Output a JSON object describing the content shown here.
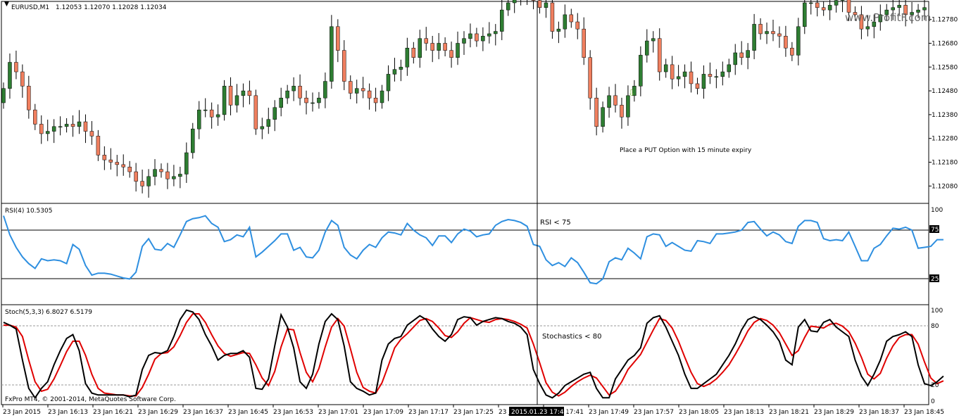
{
  "window": {
    "symbol": "EURUSD,M1",
    "quote": "1.12053 1.12070 1.12028 1.12034",
    "watermark": "www.ProfitF.com",
    "copyright": "FxPro MT4, © 2001-2014, MetaQuotes Software Corp."
  },
  "colors": {
    "bull": "#2e7d32",
    "bear": "#f07f5f",
    "wick": "#000000",
    "rsi": "#2e8fe0",
    "stoch_main": "#000000",
    "stoch_signal": "#e00000",
    "arrow": "#7fbf3f"
  },
  "cursor_time_label": "2015.01.23 17:40",
  "price_panel": {
    "ylim": [
      1.1201,
      1.1285
    ],
    "ticks": [
      "1.12780",
      "1.12680",
      "1.12580",
      "1.12480",
      "1.12380",
      "1.12280",
      "1.12180",
      "1.12080"
    ],
    "annotation": "Place a PUT Option with 15 minute expiry",
    "arrow_icon": "down-arrow-icon"
  },
  "rsi_panel": {
    "label": "RSI(4) 10.5305",
    "ticks": [
      "100",
      "75",
      "25",
      "0"
    ],
    "levels": [
      75,
      25
    ],
    "annotation": "RSI < 75"
  },
  "stoch_panel": {
    "label": "Stoch(5,3,3) 6.8027 6.5179",
    "ticks": [
      "100",
      "80",
      "20",
      "0"
    ],
    "levels": [
      80,
      20
    ],
    "annotation": "Stochastics < 80"
  },
  "x_axis": {
    "labels": [
      "23 Jan 2015",
      "23 Jan 16:13",
      "23 Jan 16:21",
      "23 Jan 16:29",
      "23 Jan 16:37",
      "23 Jan 16:45",
      "23 Jan 16:53",
      "23 Jan 17:01",
      "23 Jan 17:09",
      "23 Jan 17:17",
      "23 Jan 17:25",
      "23 Jan 17:33",
      "23 Jan 17:41",
      "23 Jan 17:49",
      "23 Jan 17:57",
      "23 Jan 18:05",
      "23 Jan 18:13",
      "23 Jan 18:21",
      "23 Jan 18:29",
      "23 Jan 18:37",
      "23 Jan 18:45"
    ]
  },
  "chart_data": {
    "type": "candlestick",
    "symbol": "EURUSD",
    "timeframe": "M1",
    "series": [
      {
        "name": "EURUSD,M1",
        "close": [
          1.1249,
          1.126,
          1.1256,
          1.125,
          1.124,
          1.1234,
          1.123,
          1.1231,
          1.1233,
          1.1233,
          1.1234,
          1.1233,
          1.1235,
          1.1231,
          1.1229,
          1.1221,
          1.1219,
          1.1218,
          1.1217,
          1.1216,
          1.1214,
          1.121,
          1.1208,
          1.1212,
          1.1215,
          1.1214,
          1.1211,
          1.1212,
          1.1213,
          1.1222,
          1.1232,
          1.124,
          1.124,
          1.1237,
          1.1238,
          1.125,
          1.1242,
          1.1246,
          1.1248,
          1.1246,
          1.1232,
          1.1233,
          1.1236,
          1.1241,
          1.1245,
          1.1248,
          1.125,
          1.1245,
          1.1243,
          1.1243,
          1.1245,
          1.1252,
          1.1275,
          1.1265,
          1.1252,
          1.1247,
          1.1249,
          1.1248,
          1.1245,
          1.1243,
          1.1248,
          1.1255,
          1.1257,
          1.1258,
          1.1266,
          1.1262,
          1.127,
          1.1268,
          1.1265,
          1.1268,
          1.1265,
          1.1262,
          1.1268,
          1.127,
          1.1272,
          1.1269,
          1.1271,
          1.1272,
          1.1273,
          1.1282,
          1.1285,
          1.1287,
          1.1289,
          1.129,
          1.1286,
          1.1283,
          1.1285,
          1.1273,
          1.1274,
          1.128,
          1.1277,
          1.1274,
          1.1262,
          1.1245,
          1.1233,
          1.1241,
          1.1246,
          1.1242,
          1.1237,
          1.1246,
          1.125,
          1.1263,
          1.1269,
          1.127,
          1.1256,
          1.1259,
          1.1253,
          1.1254,
          1.1256,
          1.1251,
          1.1249,
          1.1255,
          1.1254,
          1.1254,
          1.1256,
          1.1259,
          1.1264,
          1.1262,
          1.1265,
          1.1276,
          1.1272,
          1.1273,
          1.1272,
          1.1271,
          1.1266,
          1.1263,
          1.1275,
          1.1285,
          1.1285,
          1.1283,
          1.1282,
          1.1284,
          1.1286,
          1.1287,
          1.1281,
          1.128,
          1.1274,
          1.1275,
          1.1277,
          1.128,
          1.1282,
          1.1283,
          1.1284,
          1.128,
          1.1281,
          1.1282,
          1.1283
        ]
      },
      {
        "name": "RSI(4)",
        "values": [
          90,
          70,
          57,
          47,
          40,
          35,
          45,
          43,
          44,
          43,
          40,
          60,
          55,
          38,
          28,
          30,
          30,
          29,
          27,
          25,
          24,
          31,
          58,
          66,
          55,
          54,
          61,
          57,
          70,
          84,
          87,
          88,
          90,
          82,
          78,
          63,
          65,
          70,
          68,
          78,
          47,
          52,
          58,
          64,
          71,
          71,
          54,
          57,
          47,
          46,
          54,
          73,
          85,
          80,
          57,
          49,
          45,
          54,
          60,
          57,
          67,
          73,
          72,
          70,
          82,
          75,
          70,
          67,
          59,
          69,
          69,
          62,
          71,
          76,
          74,
          68,
          70,
          71,
          80,
          84,
          86,
          85,
          83,
          79,
          60,
          58,
          44,
          38,
          41,
          37,
          46,
          41,
          31,
          20,
          19,
          24,
          42,
          46,
          44,
          56,
          51,
          45,
          68,
          71,
          70,
          58,
          62,
          58,
          54,
          53,
          64,
          63,
          61,
          71,
          71,
          72,
          73,
          75,
          83,
          84,
          76,
          69,
          73,
          70,
          63,
          61,
          79,
          85,
          85,
          83,
          66,
          64,
          65,
          64,
          73,
          58,
          43,
          43,
          56,
          60,
          69,
          77,
          76,
          78,
          75,
          56,
          57,
          58,
          65,
          65
        ]
      },
      {
        "name": "Stoch(5,3,3) main",
        "values": [
          85,
          82,
          78,
          45,
          15,
          5,
          15,
          22,
          40,
          55,
          68,
          72,
          55,
          20,
          10,
          8,
          8,
          8,
          8,
          8,
          6,
          8,
          35,
          50,
          53,
          52,
          55,
          70,
          88,
          98,
          96,
          88,
          72,
          60,
          45,
          50,
          52,
          52,
          55,
          48,
          15,
          14,
          25,
          60,
          93,
          80,
          58,
          22,
          15,
          30,
          62,
          86,
          94,
          88,
          60,
          22,
          15,
          12,
          8,
          10,
          45,
          62,
          68,
          70,
          82,
          87,
          92,
          88,
          78,
          70,
          65,
          72,
          88,
          91,
          90,
          82,
          86,
          88,
          90,
          89,
          86,
          84,
          80,
          72,
          35,
          20,
          8,
          5,
          10,
          18,
          22,
          26,
          30,
          32,
          15,
          5,
          5,
          25,
          35,
          45,
          50,
          58,
          84,
          90,
          92,
          80,
          65,
          50,
          30,
          15,
          15,
          20,
          25,
          30,
          40,
          50,
          62,
          77,
          88,
          91,
          88,
          82,
          75,
          65,
          45,
          40,
          80,
          88,
          76,
          75,
          85,
          88,
          80,
          75,
          70,
          45,
          28,
          18,
          30,
          45,
          65,
          70,
          72,
          75,
          70,
          40,
          20,
          18,
          22,
          28
        ]
      },
      {
        "name": "Stoch(5,3,3) signal",
        "values": [
          82,
          82,
          80,
          70,
          45,
          22,
          12,
          14,
          25,
          39,
          54,
          65,
          65,
          50,
          30,
          15,
          10,
          9,
          8,
          8,
          7,
          7,
          16,
          30,
          46,
          52,
          53,
          59,
          71,
          85,
          94,
          94,
          85,
          72,
          60,
          52,
          49,
          51,
          53,
          52,
          40,
          26,
          18,
          33,
          59,
          78,
          77,
          53,
          32,
          22,
          36,
          59,
          80,
          89,
          81,
          57,
          32,
          16,
          12,
          10,
          21,
          39,
          58,
          67,
          73,
          80,
          87,
          89,
          86,
          79,
          71,
          69,
          75,
          84,
          90,
          88,
          86,
          85,
          88,
          89,
          88,
          86,
          83,
          79,
          62,
          42,
          21,
          11,
          7,
          11,
          17,
          22,
          26,
          29,
          26,
          17,
          8,
          12,
          22,
          35,
          43,
          51,
          64,
          77,
          89,
          87,
          79,
          65,
          48,
          32,
          20,
          17,
          20,
          25,
          32,
          40,
          51,
          63,
          76,
          85,
          89,
          87,
          82,
          74,
          62,
          50,
          55,
          69,
          81,
          80,
          79,
          83,
          84,
          81,
          75,
          63,
          48,
          30,
          25,
          31,
          47,
          60,
          69,
          72,
          72,
          62,
          43,
          26,
          20,
          23
        ]
      }
    ],
    "ylim": [
      1.1201,
      1.1285
    ],
    "annotations": [
      "Place a PUT Option with 15 minute expiry",
      "RSI < 75",
      "Stochastics < 80"
    ]
  }
}
